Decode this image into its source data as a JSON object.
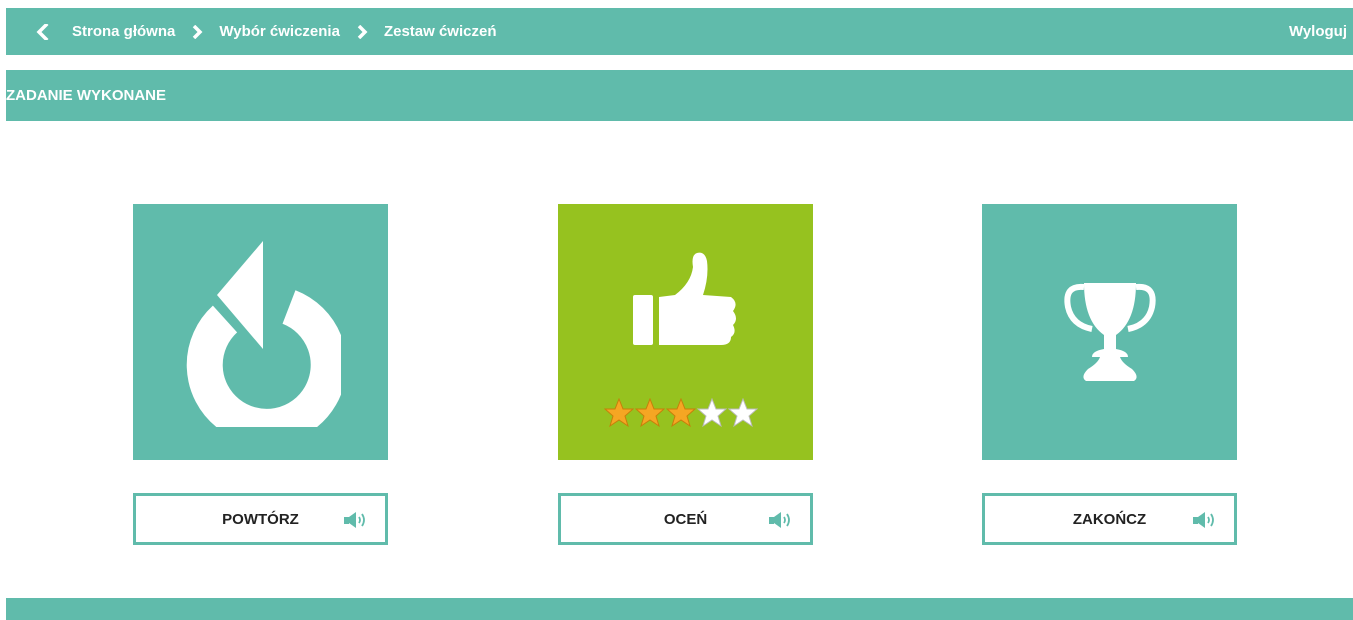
{
  "nav": {
    "back_icon": "chevron-left-icon",
    "breadcrumb": [
      "Strona główna",
      "Wybór ćwiczenia",
      "Zestaw ćwiczeń"
    ],
    "separator_icon": "chevron-right-icon",
    "logout": "Wyloguj"
  },
  "title": "ZADANIE WYKONANE",
  "tiles": [
    {
      "icon": "replay-icon",
      "label": "POWTÓRZ",
      "sound_icon": "speaker-icon",
      "color": "#60bbab"
    },
    {
      "icon": "thumbs-up-icon",
      "label": "OCEŃ",
      "sound_icon": "speaker-icon",
      "color": "#96c21f",
      "rating": 3,
      "rating_max": 5
    },
    {
      "icon": "trophy-icon",
      "label": "ZAKOŃCZ",
      "sound_icon": "speaker-icon",
      "color": "#60bbab"
    }
  ],
  "colors": {
    "accent": "#60bbab",
    "rate_tile": "#96c21f",
    "star_filled": "#f5a623",
    "star_empty": "#ffffff"
  }
}
